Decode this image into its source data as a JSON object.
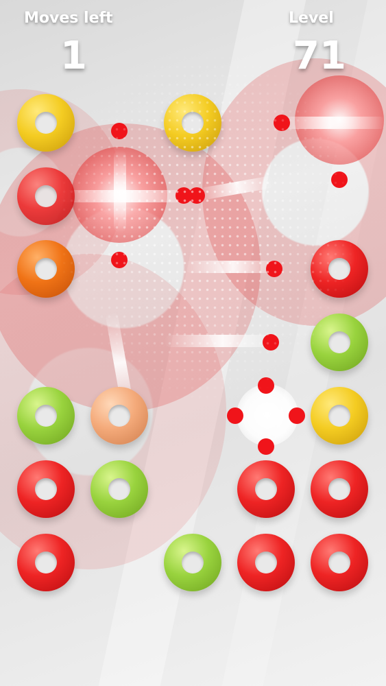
{
  "hud": {
    "moves_label": "Moves left",
    "moves_value": "1",
    "level_label": "Level",
    "level_value": "71"
  },
  "board": {
    "rings": [
      {
        "name": "ring-r1-c1",
        "color": "yellow"
      },
      {
        "name": "ring-r1-c3",
        "color": "yellow"
      },
      {
        "name": "ring-r2-c1",
        "color": "red"
      },
      {
        "name": "ring-r3-c1",
        "color": "orange"
      },
      {
        "name": "ring-r3-c5",
        "color": "red"
      },
      {
        "name": "ring-r4-c5",
        "color": "green"
      },
      {
        "name": "ring-r5-c1",
        "color": "green"
      },
      {
        "name": "ring-r5-c2",
        "color": "peach"
      },
      {
        "name": "ring-r5-c5",
        "color": "yellow"
      },
      {
        "name": "ring-r6-c1",
        "color": "red"
      },
      {
        "name": "ring-r6-c2",
        "color": "green"
      },
      {
        "name": "ring-r6-c4",
        "color": "red"
      },
      {
        "name": "ring-r6-c5",
        "color": "red"
      },
      {
        "name": "ring-r7-c1",
        "color": "red"
      },
      {
        "name": "ring-r7-c3",
        "color": "green"
      },
      {
        "name": "ring-r7-c4",
        "color": "red"
      },
      {
        "name": "ring-r7-c5",
        "color": "red"
      }
    ]
  },
  "colors": {
    "yellow": "#f4cc22",
    "red": "#ee2424",
    "orange": "#f07316",
    "green": "#99d33e",
    "peach": "#f4aa7a",
    "projectile": "#f0141a"
  }
}
